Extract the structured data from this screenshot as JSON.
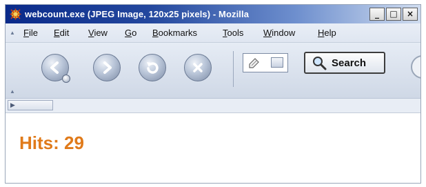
{
  "window": {
    "title": "webcount.exe (JPEG Image, 120x25 pixels) - Mozilla",
    "controls": {
      "minimize": "_",
      "maximize": "□",
      "close": "×"
    }
  },
  "menubar": {
    "items": [
      {
        "underline": "F",
        "rest": "ile"
      },
      {
        "underline": "E",
        "rest": "dit"
      },
      {
        "underline": "V",
        "rest": "iew"
      },
      {
        "underline": "G",
        "rest": "o"
      },
      {
        "underline": "B",
        "rest": "ookmarks"
      },
      {
        "underline": "T",
        "rest": "ools"
      },
      {
        "underline": "W",
        "rest": "indow"
      },
      {
        "underline": "H",
        "rest": "elp"
      }
    ]
  },
  "navbar": {
    "search_label": "Search",
    "icons": [
      "back-icon",
      "forward-icon",
      "reload-icon",
      "stop-icon",
      "magnifier-icon"
    ]
  },
  "page": {
    "content_text": "Hits: 29",
    "content_color": "#e07a1a"
  }
}
